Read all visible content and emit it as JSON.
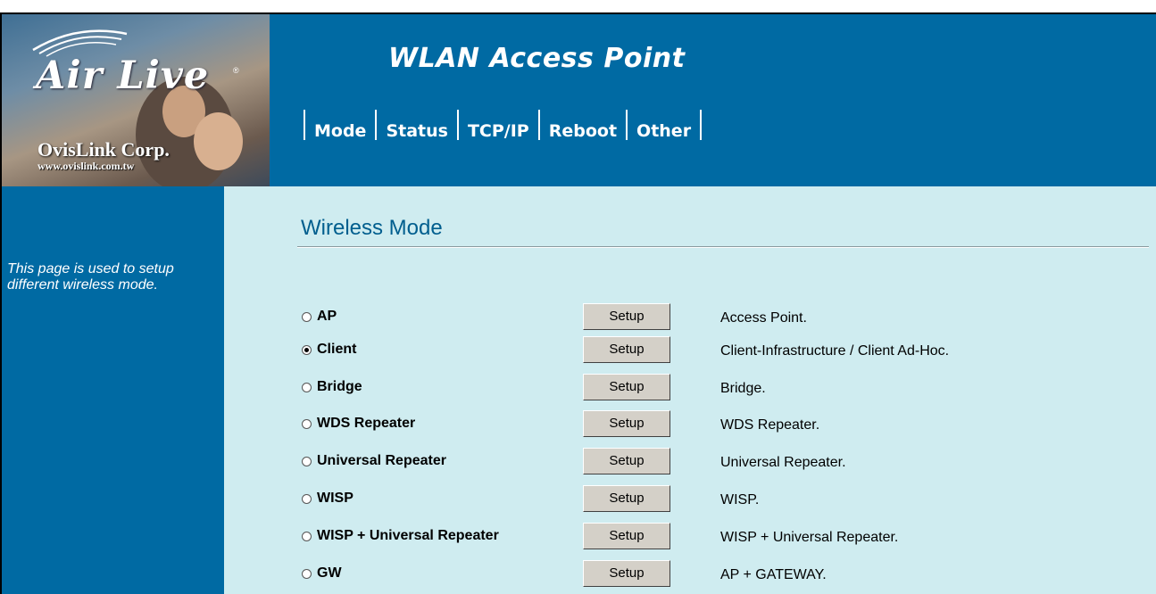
{
  "logo": {
    "brand": "Air Live",
    "registered": "®",
    "company": "OvisLink Corp.",
    "url": "www.ovislink.com.tw"
  },
  "header": {
    "title": "WLAN Access Point",
    "nav": [
      "Mode",
      "Status",
      "TCP/IP",
      "Reboot",
      "Other"
    ]
  },
  "sidebar": {
    "description": "This page is used to setup different wireless mode."
  },
  "main": {
    "title": "Wireless Mode",
    "setup_label": "Setup",
    "selected_mode": "Client",
    "modes": [
      {
        "label": "AP",
        "description": "Access Point."
      },
      {
        "label": "Client",
        "description": "Client-Infrastructure / Client Ad-Hoc."
      },
      {
        "label": "Bridge",
        "description": "Bridge."
      },
      {
        "label": "WDS Repeater",
        "description": "WDS Repeater."
      },
      {
        "label": "Universal Repeater",
        "description": "Universal Repeater."
      },
      {
        "label": "WISP",
        "description": "WISP."
      },
      {
        "label": "WISP + Universal Repeater",
        "description": "WISP + Universal Repeater."
      },
      {
        "label": "GW",
        "description": "AP + GATEWAY."
      }
    ]
  },
  "colors": {
    "header_bg": "#006aa3",
    "content_bg": "#cfecf0",
    "title_color": "#005e8e",
    "button_bg": "#d4d0c8"
  }
}
